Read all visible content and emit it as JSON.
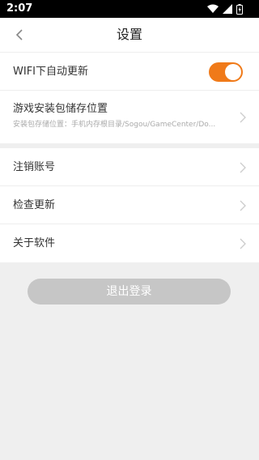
{
  "statusbar": {
    "time": "2:07"
  },
  "header": {
    "title": "设置"
  },
  "settings": {
    "wifi_update": {
      "label": "WIFI下自动更新",
      "enabled": true
    },
    "storage": {
      "label": "游戏安装包储存位置",
      "path": "安装包存储位置：手机内存根目录/Sogou/GameCenter/Do..."
    }
  },
  "account": {
    "items": [
      {
        "label": "注销账号"
      },
      {
        "label": "检查更新"
      },
      {
        "label": "关于软件"
      }
    ]
  },
  "logout_label": "退出登录",
  "colors": {
    "accent": "#f07a19",
    "button_disabled": "#c6c6c6",
    "background": "#efefef"
  }
}
